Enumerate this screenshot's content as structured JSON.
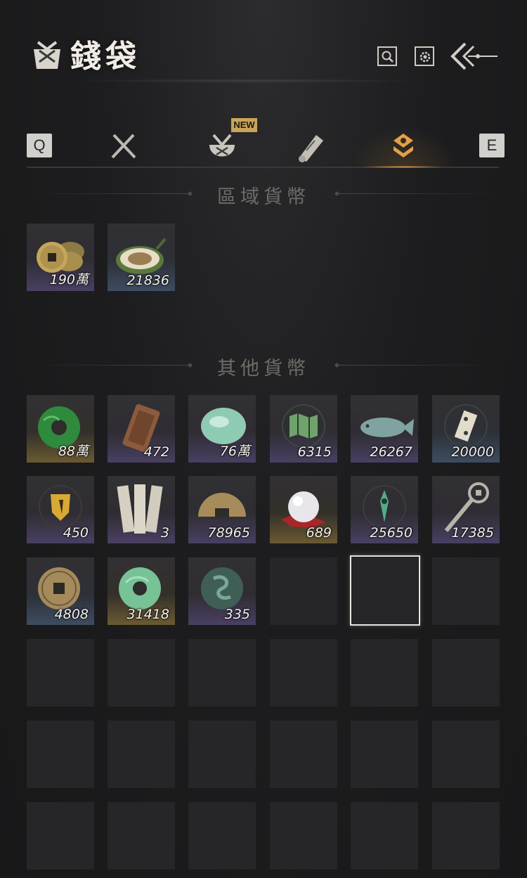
{
  "header": {
    "title": "錢袋",
    "icons": [
      "pouch-icon",
      "search-icon",
      "settings-icon",
      "back-arrow-icon"
    ]
  },
  "tabs": {
    "prev_key": "Q",
    "next_key": "E",
    "new_badge": "NEW",
    "items": [
      "swords-icon",
      "bundle-icon",
      "scroll-icon",
      "currency-icon"
    ],
    "active_index": 3,
    "accent_color": "#e2a04a"
  },
  "regional": {
    "title": "區域貨幣",
    "items": [
      {
        "name": "copper-coins-icon",
        "qty": "190萬",
        "rarity": "purple"
      },
      {
        "name": "melon-icon",
        "qty": "21836",
        "rarity": "blue"
      }
    ]
  },
  "other": {
    "title": "其他貨幣",
    "items": [
      {
        "name": "jade-ring-icon",
        "qty": "88萬",
        "rarity": "gold"
      },
      {
        "name": "bronze-token-icon",
        "qty": "472",
        "rarity": "purple"
      },
      {
        "name": "jade-stone-icon",
        "qty": "76萬",
        "rarity": "purple"
      },
      {
        "name": "map-emblem-icon",
        "qty": "6315",
        "rarity": "purple"
      },
      {
        "name": "jade-fish-icon",
        "qty": "26267",
        "rarity": "purple"
      },
      {
        "name": "domino-emblem-icon",
        "qty": "20000",
        "rarity": "blue"
      },
      {
        "name": "gold-shield-icon",
        "qty": "450",
        "rarity": "purple"
      },
      {
        "name": "bamboo-slips-icon",
        "qty": "3",
        "rarity": "purple"
      },
      {
        "name": "half-coin-icon",
        "qty": "78965",
        "rarity": "purple"
      },
      {
        "name": "pearl-icon",
        "qty": "689",
        "rarity": "gold"
      },
      {
        "name": "green-sigil-icon",
        "qty": "25650",
        "rarity": "purple"
      },
      {
        "name": "coin-sword-icon",
        "qty": "17385",
        "rarity": "purple"
      },
      {
        "name": "ancient-coin-icon",
        "qty": "4808",
        "rarity": "blue"
      },
      {
        "name": "jade-disc-icon",
        "qty": "31418",
        "rarity": "gold"
      },
      {
        "name": "dragon-token-icon",
        "qty": "335",
        "rarity": "purple"
      }
    ],
    "empty_slots": 21
  }
}
